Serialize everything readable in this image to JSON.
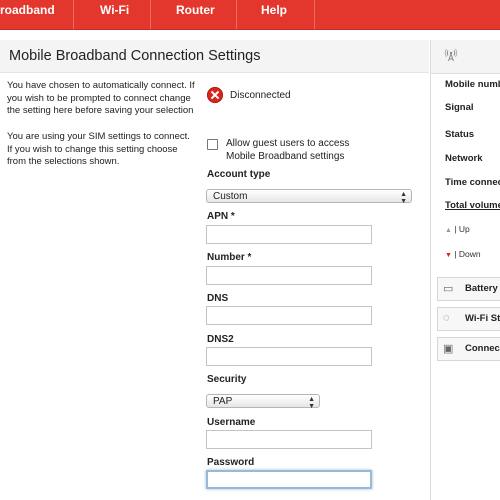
{
  "nav": {
    "items": [
      "roadband",
      "Wi-Fi",
      "Router",
      "Help"
    ]
  },
  "page": {
    "title": "Mobile Broadband Connection Settings",
    "help1": "You have chosen to automatically connect. If you wish to be prompted to connect change the setting here before saving your selection",
    "help2": "You are using your SIM settings to connect. If you wish to change this setting choose from the selections shown."
  },
  "status": {
    "text": "Disconnected",
    "icon": "error-x-icon"
  },
  "guest": {
    "label": "Allow guest users to access Mobile Broadband settings"
  },
  "form": {
    "account_type_label": "Account type",
    "account_type_value": "Custom",
    "apn_label": "APN *",
    "apn_value": "",
    "number_label": "Number *",
    "number_value": "",
    "dns_label": "DNS",
    "dns_value": "",
    "dns2_label": "DNS2",
    "dns2_value": "",
    "security_label": "Security",
    "security_value": "PAP",
    "username_label": "Username",
    "username_value": "",
    "password_label": "Password",
    "password_value": ""
  },
  "sidebar": {
    "mobile_number": "Mobile numb",
    "signal": "Signal",
    "status": "Status",
    "network": "Network",
    "time_connected": "Time connec",
    "total_volume": "Total volume",
    "up": "| Up",
    "down": "| Down",
    "battery": "Battery",
    "wifi_status": "Wi-Fi Sta",
    "connected": "Connect"
  },
  "colors": {
    "brand_red": "#e3362c",
    "error_red": "#d9261c"
  }
}
